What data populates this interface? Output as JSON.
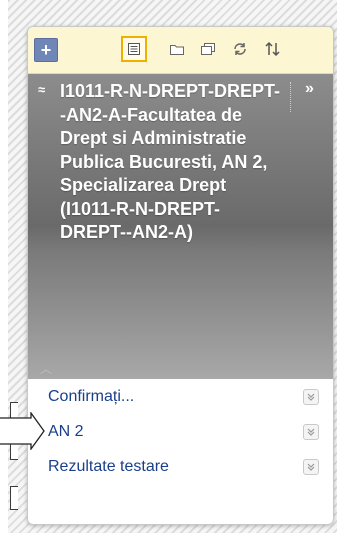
{
  "toolbar": {
    "add_symbol": "+",
    "icons": [
      "add-icon",
      "list-view-icon",
      "folder-icon",
      "window-icon",
      "refresh-icon",
      "sort-icon"
    ]
  },
  "course": {
    "title": "I1011-R-N-DREPT-DREPT--AN2-A-Facultatea de Drept si Administratie Publica Bucuresti, AN 2, Specializarea Drept (I1011-R-N-DREPT-DREPT--AN2-A)",
    "collapse_symbol": "≈",
    "expand_symbol": "»"
  },
  "menu": {
    "items": [
      {
        "label": "Confirmați..."
      },
      {
        "label": "AN 2"
      },
      {
        "label": "Rezultate testare"
      }
    ]
  },
  "colors": {
    "toolbar_bg": "#fdf6d2",
    "active_border": "#f0b000",
    "header_bg": "#7a7a7a",
    "link": "#1a3f8a"
  }
}
